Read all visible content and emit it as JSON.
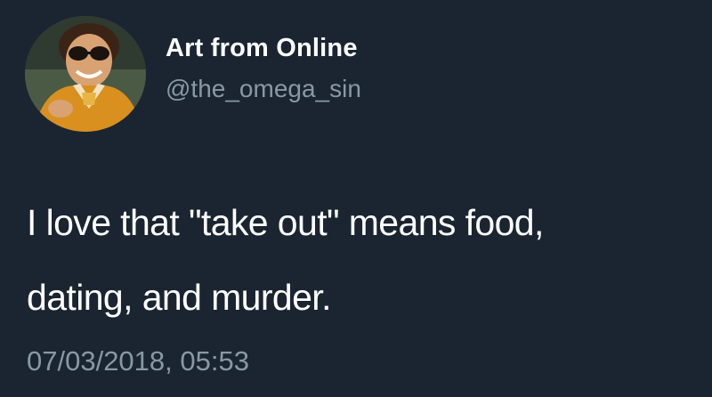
{
  "account": {
    "display_name": "Art from Online",
    "handle": "@the_omega_sin",
    "avatar_icon": "profile-photo-man-sunglasses"
  },
  "tweet": {
    "lines": [
      "I love that \"take out\" means food,",
      "dating, and murder."
    ],
    "timestamp": "07/03/2018, 05:53"
  },
  "colors": {
    "background": "#1b2531",
    "primary_text": "#ffffff",
    "secondary_text": "#8899a6"
  }
}
